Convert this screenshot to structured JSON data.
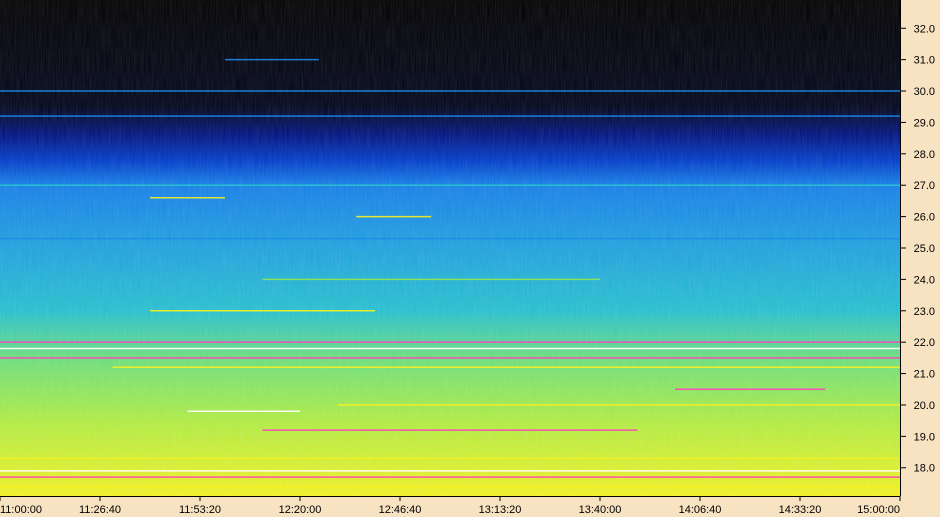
{
  "chart_data": {
    "type": "heatmap",
    "title": "",
    "xlabel": "",
    "ylabel": "",
    "x_ticks": [
      "11:00:00",
      "11:26:40",
      "11:53:20",
      "12:20:00",
      "12:46:40",
      "13:13:20",
      "13:40:00",
      "14:06:40",
      "14:33:20",
      "15:00:00"
    ],
    "xlim": [
      "11:00:00",
      "15:00:00"
    ],
    "y_ticks": [
      "18.0",
      "19.0",
      "20.0",
      "21.0",
      "22.0",
      "23.0",
      "24.0",
      "25.0",
      "26.0",
      "27.0",
      "28.0",
      "29.0",
      "30.0",
      "31.0",
      "32.0"
    ],
    "ylim": [
      17.1,
      32.9
    ],
    "colormap": [
      "#000000",
      "#0018a0",
      "#0050e0",
      "#1a8ae8",
      "#28c8c8",
      "#90e850",
      "#f8f020",
      "#ff40c0",
      "#ffffff"
    ],
    "background_color": "#f7e3c2",
    "intensity_profile": [
      {
        "y": 32.9,
        "level": 0.0
      },
      {
        "y": 29.5,
        "level": 0.02
      },
      {
        "y": 28.6,
        "level": 0.1
      },
      {
        "y": 27.8,
        "level": 0.2
      },
      {
        "y": 27.0,
        "level": 0.35
      },
      {
        "y": 25.0,
        "level": 0.42
      },
      {
        "y": 23.0,
        "level": 0.48
      },
      {
        "y": 21.5,
        "level": 0.58
      },
      {
        "y": 19.5,
        "level": 0.66
      },
      {
        "y": 17.1,
        "level": 0.74
      }
    ],
    "line_features": [
      {
        "y": 30.0,
        "x_start": "11:00:00",
        "x_end": "15:00:00",
        "color": "#1a8ae8"
      },
      {
        "y": 29.2,
        "x_start": "11:00:00",
        "x_end": "15:00:00",
        "color": "#1a8ae8"
      },
      {
        "y": 27.0,
        "x_start": "11:00:00",
        "x_end": "15:00:00",
        "color": "#28c8c8"
      },
      {
        "y": 25.3,
        "x_start": "11:00:00",
        "x_end": "15:00:00",
        "color": "#1a8ae8"
      },
      {
        "y": 24.0,
        "x_start": "12:10:00",
        "x_end": "13:40:00",
        "color": "#90e850"
      },
      {
        "y": 23.0,
        "x_start": "11:40:00",
        "x_end": "12:40:00",
        "color": "#f8f020"
      },
      {
        "y": 22.0,
        "x_start": "11:00:00",
        "x_end": "15:00:00",
        "color": "#ff40c0"
      },
      {
        "y": 21.8,
        "x_start": "11:00:00",
        "x_end": "15:00:00",
        "color": "#ffffff"
      },
      {
        "y": 21.5,
        "x_start": "11:00:00",
        "x_end": "15:00:00",
        "color": "#ff40c0"
      },
      {
        "y": 21.2,
        "x_start": "11:30:00",
        "x_end": "15:00:00",
        "color": "#f8f020"
      },
      {
        "y": 20.5,
        "x_start": "14:00:00",
        "x_end": "14:40:00",
        "color": "#ff40c0"
      },
      {
        "y": 20.0,
        "x_start": "12:30:00",
        "x_end": "15:00:00",
        "color": "#f8f020"
      },
      {
        "y": 19.8,
        "x_start": "11:50:00",
        "x_end": "12:20:00",
        "color": "#ffffff"
      },
      {
        "y": 19.2,
        "x_start": "12:10:00",
        "x_end": "13:50:00",
        "color": "#ff40c0"
      },
      {
        "y": 18.3,
        "x_start": "11:00:00",
        "x_end": "15:00:00",
        "color": "#f8f020"
      },
      {
        "y": 17.9,
        "x_start": "11:00:00",
        "x_end": "15:00:00",
        "color": "#ffffff"
      },
      {
        "y": 17.7,
        "x_start": "11:00:00",
        "x_end": "15:00:00",
        "color": "#ff40c0"
      },
      {
        "y": 17.4,
        "x_start": "11:00:00",
        "x_end": "15:00:00",
        "color": "#f8f020"
      },
      {
        "y": 31.0,
        "x_start": "12:00:00",
        "x_end": "12:25:00",
        "color": "#1a8ae8"
      },
      {
        "y": 26.0,
        "x_start": "12:35:00",
        "x_end": "12:55:00",
        "color": "#f8f020"
      },
      {
        "y": 26.6,
        "x_start": "11:40:00",
        "x_end": "12:00:00",
        "color": "#f8f020"
      }
    ],
    "grid": false,
    "legend": "none"
  }
}
